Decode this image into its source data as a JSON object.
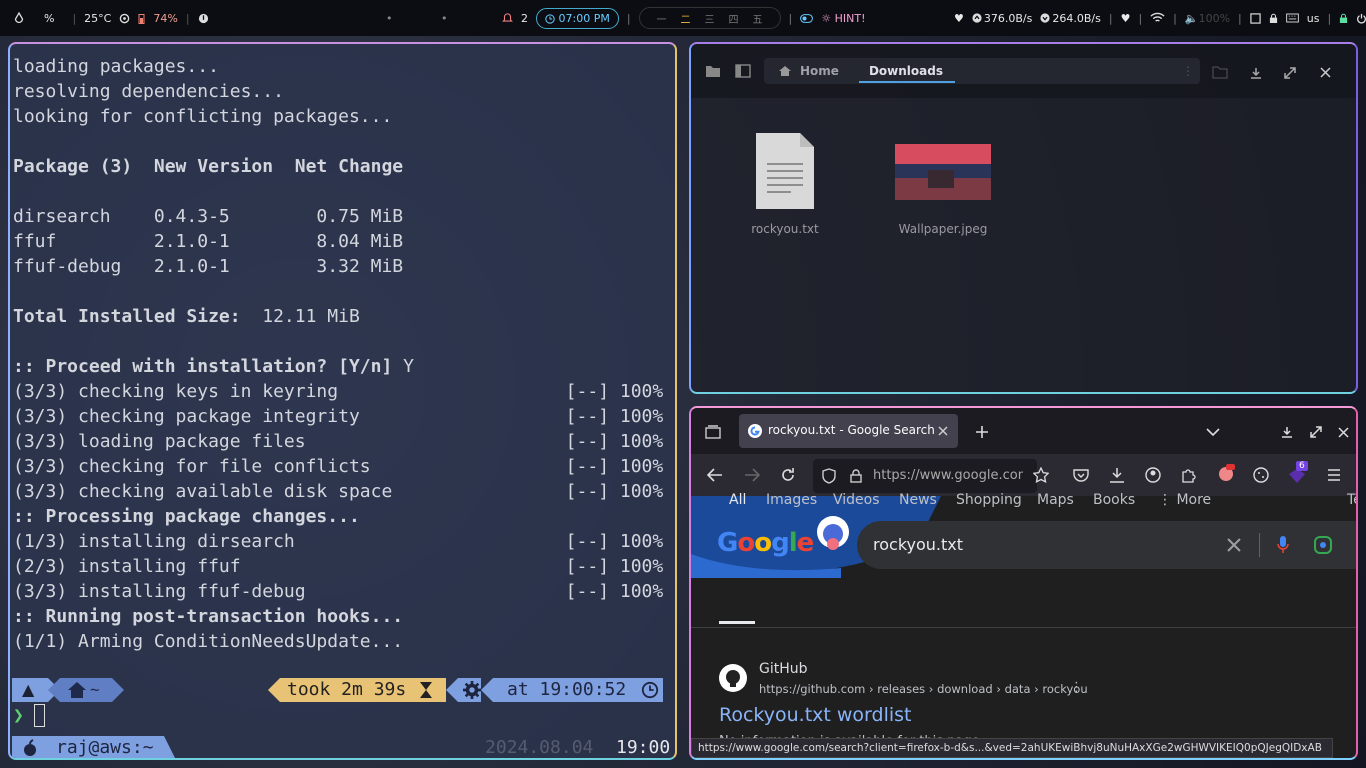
{
  "bar": {
    "temp": "25°C",
    "battery": "74%",
    "notif_count": "2",
    "time": "07:00 PM",
    "workspaces": [
      "一",
      "二",
      "三",
      "四",
      "五"
    ],
    "hint": "HINT!",
    "net_up": "376.0B/s",
    "net_down": "264.0B/s",
    "volume": "100%",
    "layout": "us"
  },
  "terminal": {
    "lines": [
      {
        "t": "loading packages..."
      },
      {
        "t": "resolving dependencies..."
      },
      {
        "t": "looking for conflicting packages..."
      },
      {
        "t": ""
      },
      {
        "t": "Package (3)  New Version  Net Change",
        "b": true
      },
      {
        "t": ""
      },
      {
        "t": "dirsearch    0.4.3-5        0.75 MiB"
      },
      {
        "t": "ffuf         2.1.0-1        8.04 MiB"
      },
      {
        "t": "ffuf-debug   2.1.0-1        3.32 MiB"
      },
      {
        "t": ""
      },
      {
        "t": "Total Installed Size:  12.11 MiB",
        "p": "Total Installed Size:"
      },
      {
        "t": ""
      },
      {
        "t": ":: Proceed with installation? [Y/n] Y",
        "p": ":: Proceed with installation? [Y/n]"
      },
      {
        "t": "(3/3) checking keys in keyring                     [--] 100%"
      },
      {
        "t": "(3/3) checking package integrity                   [--] 100%"
      },
      {
        "t": "(3/3) loading package files                        [--] 100%"
      },
      {
        "t": "(3/3) checking for file conflicts                  [--] 100%"
      },
      {
        "t": "(3/3) checking available disk space                [--] 100%"
      },
      {
        "t": ":: Processing package changes...",
        "b": true
      },
      {
        "t": "(1/3) installing dirsearch                         [--] 100%"
      },
      {
        "t": "(2/3) installing ffuf                              [--] 100%"
      },
      {
        "t": "(3/3) installing ffuf-debug                        [--] 100%"
      },
      {
        "t": ":: Running post-transaction hooks...",
        "b": true
      },
      {
        "t": "(1/1) Arming ConditionNeedsUpdate..."
      }
    ],
    "took": "took 2m 39s",
    "at": "at 19:00:52",
    "home": "~",
    "prompt_char": "❯",
    "user": "raj@aws:~",
    "date": "2024.08.04",
    "clock": "19:00"
  },
  "files": {
    "tabs": [
      "Home",
      "Downloads"
    ],
    "items": [
      {
        "name": "rockyou.txt"
      },
      {
        "name": "Wallpaper.jpeg"
      }
    ]
  },
  "firefox": {
    "tab_title": "rockyou.txt - Google Search",
    "url": "https://www.google.com/s",
    "ext_badge": "6",
    "query": "rockyou.txt",
    "tabs": [
      "All",
      "Images",
      "Videos",
      "News",
      "Shopping",
      "Maps",
      "Books",
      "More",
      "Te"
    ],
    "result": {
      "site": "GitHub",
      "path": "https://github.com › releases › download › data › rockyou",
      "title": "Rockyou.txt wordlist",
      "snippet": "No information is available for this page"
    },
    "status": "https://www.google.com/search?client=firefox-b-d&s...&ved=2ahUKEwiBhvj8uNuHAxXGe2wGHWVIKEIQ0pQJegQIDxAB"
  },
  "colors": {
    "bar": "#0c0d13",
    "terminal_bg": "#2c344e",
    "powerline_blue": "#7e9fe0",
    "powerline_gold": "#e8c376",
    "google_link": "#8ab4f8"
  }
}
